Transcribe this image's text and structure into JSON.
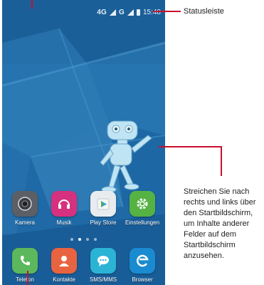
{
  "status_bar": {
    "network": "4G",
    "network_type": "G",
    "time": "15:48"
  },
  "home_screen": {
    "apps_row": [
      {
        "label": "Kamera",
        "icon": "camera-icon",
        "color": "#5c5f66"
      },
      {
        "label": "Musik",
        "icon": "headphones-icon",
        "color": "#d6317e"
      },
      {
        "label": "Play Store",
        "icon": "play-store-icon",
        "color": "#e9ecef"
      },
      {
        "label": "Einstellungen",
        "icon": "gear-icon",
        "color": "#56b343"
      }
    ],
    "dock": [
      {
        "label": "Telefon",
        "icon": "phone-icon",
        "color": "#5cb85c"
      },
      {
        "label": "Kontakte",
        "icon": "contacts-icon",
        "color": "#e8633f"
      },
      {
        "label": "SMS/MMS",
        "icon": "chat-icon",
        "color": "#2bb3d6"
      },
      {
        "label": "Browser",
        "icon": "browser-icon",
        "color": "#1a8bd0"
      }
    ],
    "page_count": 4,
    "active_page": 1
  },
  "annotations": {
    "status_bar_label": "Statusleiste",
    "swipe_lines": [
      "Streichen Sie nach",
      "rechts und links über",
      "den Startbildschirm,",
      "um Inhalte anderer",
      "Felder auf dem",
      "Startbildschirm",
      "anzusehen."
    ]
  },
  "colors": {
    "wallpaper": "#1e6aa8",
    "callout": "#c8102e"
  }
}
